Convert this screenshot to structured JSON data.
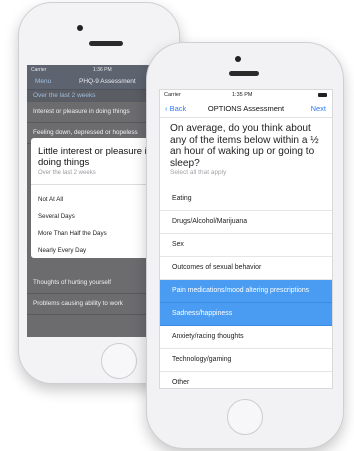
{
  "back_screen": {
    "status": {
      "carrier": "Carrier",
      "time": "1:36 PM"
    },
    "nav": {
      "menu": "Menu",
      "title": "PHQ-9 Assessment"
    },
    "section_header": "Over the last 2 weeks",
    "rows_top": [
      "Interest or pleasure in doing things",
      "Feeling down, depressed or hopeless"
    ],
    "rows_bottom": [
      "Thoughts of hurting yourself",
      "Problems causing ability to work"
    ],
    "modal": {
      "title": "Little interest or pleasure in doing things",
      "subtitle": "Over the last 2 weeks",
      "options": [
        "Not At All",
        "Several Days",
        "More Than Half the Days",
        "Nearly Every Day"
      ]
    }
  },
  "front_screen": {
    "status": {
      "carrier": "Carrier",
      "time": "1:35 PM"
    },
    "nav": {
      "back": "Back",
      "title": "OPTIONS Assessment",
      "next": "Next"
    },
    "question": "On average, do you think about any of the items below within a ½ an hour of waking up or going to sleep?",
    "hint": "Select all that apply",
    "items": [
      {
        "label": "Eating",
        "selected": false
      },
      {
        "label": "Drugs/Alcohol/Marijuana",
        "selected": false
      },
      {
        "label": "Sex",
        "selected": false
      },
      {
        "label": "Outcomes of sexual behavior",
        "selected": false
      },
      {
        "label": "Pain medications/mood altering prescriptions",
        "selected": true
      },
      {
        "label": "Sadness/happiness",
        "selected": true
      },
      {
        "label": "Anxiety/racing thoughts",
        "selected": false
      },
      {
        "label": "Technology/gaming",
        "selected": false
      },
      {
        "label": "Other",
        "selected": false
      }
    ]
  },
  "colors": {
    "accent": "#2f7cf6",
    "selected_row": "#4a9cf2",
    "dim_overlay": "#6c6c6f"
  }
}
